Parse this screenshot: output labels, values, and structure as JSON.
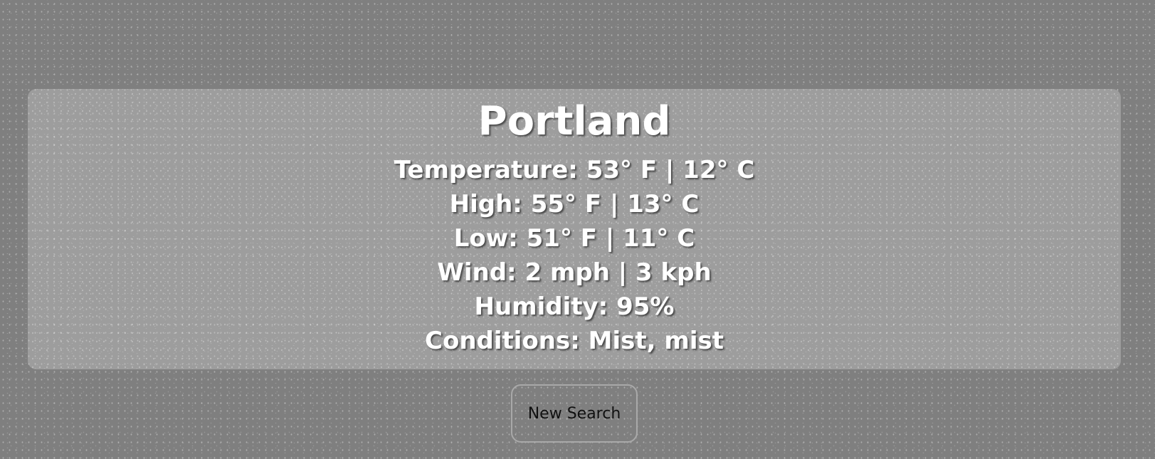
{
  "weather": {
    "city": "Portland",
    "temperature": "Temperature: 53° F | 12° C",
    "high": "High: 55° F | 13° C",
    "low": "Low: 51° F | 11° C",
    "wind": "Wind: 2 mph | 3 kph",
    "humidity": "Humidity: 95%",
    "conditions": "Conditions: Mist, mist"
  },
  "actions": {
    "new_search_label": "New Search"
  }
}
